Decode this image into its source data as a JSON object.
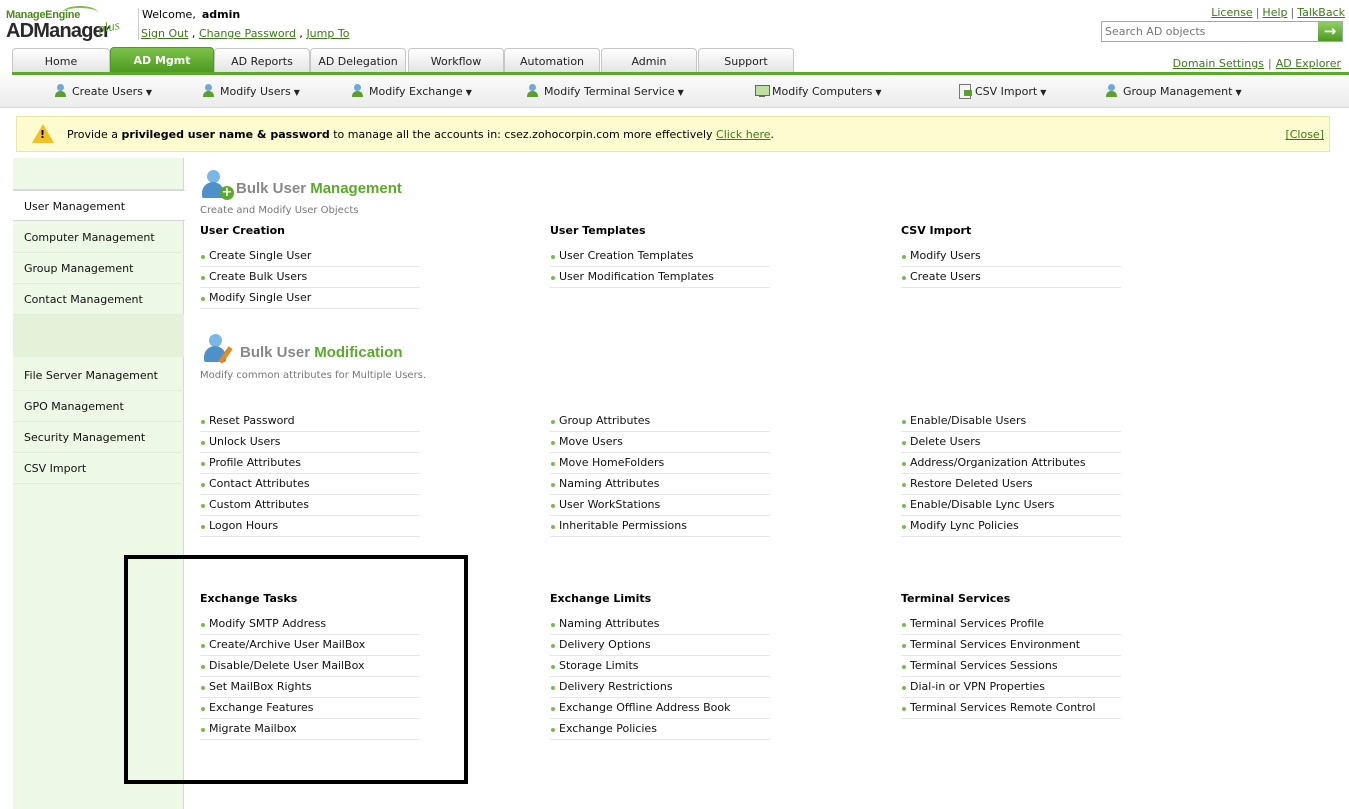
{
  "header": {
    "logo_brand": "ManageEngine",
    "logo_product": "ADManager",
    "logo_suffix": "plus",
    "welcome_label": "Welcome,",
    "user_name": "admin",
    "sign_out": "Sign Out",
    "link_comma": " , ",
    "change_password": "Change Password",
    "jump_to": "Jump To",
    "license": "License",
    "help": "Help",
    "talkback": "TalkBack",
    "sep": "|",
    "search_placeholder": "Search AD objects",
    "search_value": "Search AD objects",
    "search_go_icon": "arrow-right-icon"
  },
  "tabs": [
    {
      "label": "Home"
    },
    {
      "label": "AD Mgmt"
    },
    {
      "label": "AD Reports"
    },
    {
      "label": "AD Delegation"
    },
    {
      "label": "Workflow"
    },
    {
      "label": "Automation"
    },
    {
      "label": "Admin"
    },
    {
      "label": "Support"
    }
  ],
  "tab_links": {
    "domain_settings": "Domain Settings",
    "ad_explorer": "AD Explorer"
  },
  "submenu": [
    {
      "label": "Create Users",
      "icon": "user-add-icon"
    },
    {
      "label": "Modify Users",
      "icon": "user-edit-icon"
    },
    {
      "label": "Modify Exchange",
      "icon": "exchange-icon"
    },
    {
      "label": "Modify Terminal Service",
      "icon": "terminal-icon"
    },
    {
      "label": "Modify Computers",
      "icon": "computer-icon"
    },
    {
      "label": "CSV Import",
      "icon": "csv-icon"
    },
    {
      "label": "Group Management",
      "icon": "group-icon"
    }
  ],
  "notice": {
    "prefix": "Provide a ",
    "bold": "privileged user name & password",
    "middle": " to manage all the accounts in: csez.zohocorpin.com more effectively ",
    "link": "Click here",
    "suffix": ".",
    "close": "[Close]",
    "warning_symbol": "!"
  },
  "sidebar": {
    "items": [
      {
        "label": "User Management",
        "active": true
      },
      {
        "label": "Computer Management"
      },
      {
        "label": "Group Management"
      },
      {
        "label": "Contact Management"
      },
      {
        "label": "File Server Management"
      },
      {
        "label": "GPO Management"
      },
      {
        "label": "Security Management"
      },
      {
        "label": "CSV Import"
      }
    ]
  },
  "bulk_user_mgmt": {
    "title_a": "Bulk User ",
    "title_b": "Management",
    "subtitle": "Create and Modify User Objects",
    "groups": [
      {
        "title": "User Creation",
        "links": [
          "Create Single User",
          "Create Bulk Users",
          "Modify Single User"
        ]
      },
      {
        "title": "User Templates",
        "links": [
          "User Creation Templates",
          "User Modification Templates"
        ]
      },
      {
        "title": "CSV Import",
        "links": [
          "Modify Users",
          "Create Users"
        ]
      }
    ]
  },
  "bulk_user_mod": {
    "title_a": "Bulk User ",
    "title_b": "Modification",
    "subtitle": "Modify common attributes for Multiple Users.",
    "columns": [
      [
        "Reset Password",
        "Unlock Users",
        "Profile Attributes",
        "Contact Attributes",
        "Custom Attributes",
        "Logon Hours"
      ],
      [
        "Group Attributes",
        "Move Users",
        "Move HomeFolders",
        "Naming Attributes",
        "User WorkStations",
        "Inheritable Permissions"
      ],
      [
        "Enable/Disable Users",
        "Delete Users",
        "Address/Organization Attributes",
        "Restore Deleted Users",
        "Enable/Disable Lync Users",
        "Modify Lync Policies"
      ]
    ]
  },
  "exchange": {
    "groups": [
      {
        "title": "Exchange Tasks",
        "links": [
          "Modify SMTP Address",
          "Create/Archive User MailBox",
          "Disable/Delete User MailBox",
          "Set MailBox Rights",
          "Exchange Features",
          "Migrate Mailbox"
        ]
      },
      {
        "title": "Exchange Limits",
        "links": [
          "Naming Attributes",
          "Delivery Options",
          "Storage Limits",
          "Delivery Restrictions",
          "Exchange Offline Address Book",
          "Exchange Policies"
        ]
      },
      {
        "title": "Terminal Services",
        "links": [
          "Terminal Services Profile",
          "Terminal Services Environment",
          "Terminal Services Sessions",
          "Dial-in or VPN Properties",
          "Terminal Services Remote Control"
        ]
      }
    ]
  },
  "colors": {
    "accent_green": "#5aa92b",
    "link_green": "#3a7a16",
    "notice_bg": "#fdfbd0",
    "sidebar_bg": "#eef8e6"
  }
}
